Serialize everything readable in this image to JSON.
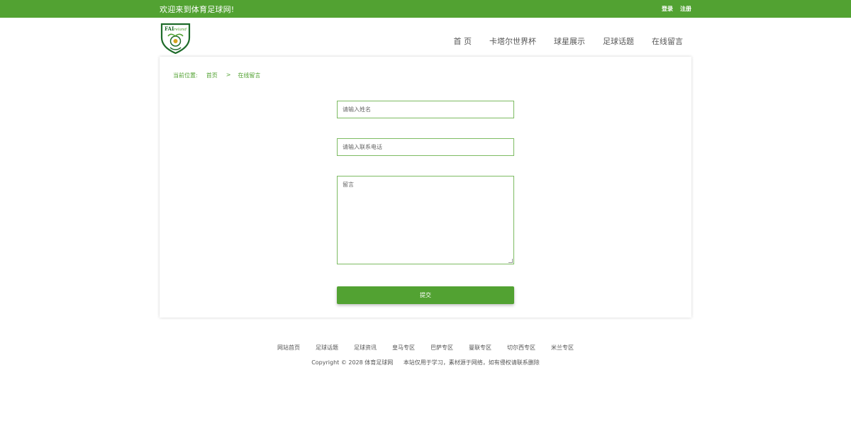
{
  "topbar": {
    "welcome": "欢迎来到体育足球网!",
    "login": "登录",
    "register": "注册",
    "bg_color": "#52a232"
  },
  "logo": {
    "icon": "fai-ireland-shield-logo",
    "text": "FAIreland"
  },
  "nav": {
    "items": [
      "首 页",
      "卡塔尔世界杯",
      "球星展示",
      "足球话题",
      "在线留言"
    ]
  },
  "breadcrumb": {
    "label": "当前位置:",
    "home": "首页",
    "separator": ">",
    "current": "在线留言"
  },
  "form": {
    "name_placeholder": "请输入姓名",
    "phone_placeholder": "请输入联系电话",
    "message_placeholder": "留言",
    "submit_label": "提交",
    "accent_color": "#52a232"
  },
  "footer": {
    "links": [
      "网站首页",
      "足球话题",
      "足球资讯",
      "皇马专区",
      "巴萨专区",
      "曼联专区",
      "切尔西专区",
      "米兰专区"
    ],
    "copyright": "Copyright © 2028 体育足球网",
    "notice": "本站仅用于学习，素材源于网络，如有侵权请联系删除"
  }
}
